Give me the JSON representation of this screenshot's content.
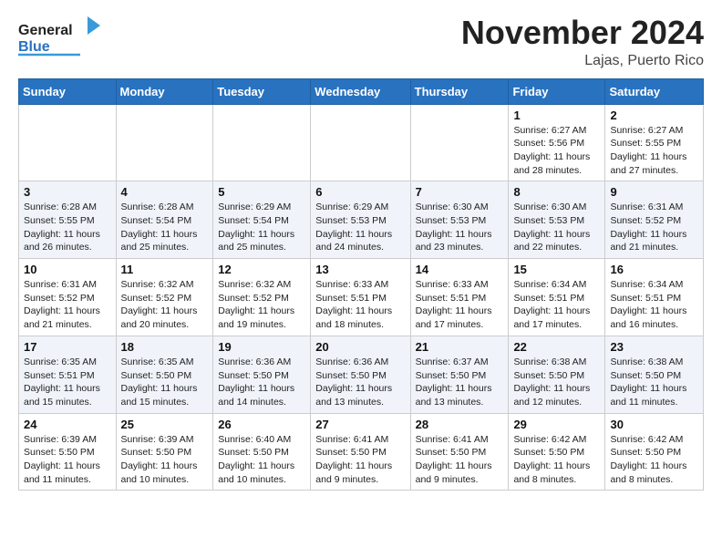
{
  "header": {
    "logo_line1": "General",
    "logo_line2": "Blue",
    "month": "November 2024",
    "location": "Lajas, Puerto Rico"
  },
  "weekdays": [
    "Sunday",
    "Monday",
    "Tuesday",
    "Wednesday",
    "Thursday",
    "Friday",
    "Saturday"
  ],
  "weeks": [
    [
      {
        "day": "",
        "info": ""
      },
      {
        "day": "",
        "info": ""
      },
      {
        "day": "",
        "info": ""
      },
      {
        "day": "",
        "info": ""
      },
      {
        "day": "",
        "info": ""
      },
      {
        "day": "1",
        "info": "Sunrise: 6:27 AM\nSunset: 5:56 PM\nDaylight: 11 hours\nand 28 minutes."
      },
      {
        "day": "2",
        "info": "Sunrise: 6:27 AM\nSunset: 5:55 PM\nDaylight: 11 hours\nand 27 minutes."
      }
    ],
    [
      {
        "day": "3",
        "info": "Sunrise: 6:28 AM\nSunset: 5:55 PM\nDaylight: 11 hours\nand 26 minutes."
      },
      {
        "day": "4",
        "info": "Sunrise: 6:28 AM\nSunset: 5:54 PM\nDaylight: 11 hours\nand 25 minutes."
      },
      {
        "day": "5",
        "info": "Sunrise: 6:29 AM\nSunset: 5:54 PM\nDaylight: 11 hours\nand 25 minutes."
      },
      {
        "day": "6",
        "info": "Sunrise: 6:29 AM\nSunset: 5:53 PM\nDaylight: 11 hours\nand 24 minutes."
      },
      {
        "day": "7",
        "info": "Sunrise: 6:30 AM\nSunset: 5:53 PM\nDaylight: 11 hours\nand 23 minutes."
      },
      {
        "day": "8",
        "info": "Sunrise: 6:30 AM\nSunset: 5:53 PM\nDaylight: 11 hours\nand 22 minutes."
      },
      {
        "day": "9",
        "info": "Sunrise: 6:31 AM\nSunset: 5:52 PM\nDaylight: 11 hours\nand 21 minutes."
      }
    ],
    [
      {
        "day": "10",
        "info": "Sunrise: 6:31 AM\nSunset: 5:52 PM\nDaylight: 11 hours\nand 21 minutes."
      },
      {
        "day": "11",
        "info": "Sunrise: 6:32 AM\nSunset: 5:52 PM\nDaylight: 11 hours\nand 20 minutes."
      },
      {
        "day": "12",
        "info": "Sunrise: 6:32 AM\nSunset: 5:52 PM\nDaylight: 11 hours\nand 19 minutes."
      },
      {
        "day": "13",
        "info": "Sunrise: 6:33 AM\nSunset: 5:51 PM\nDaylight: 11 hours\nand 18 minutes."
      },
      {
        "day": "14",
        "info": "Sunrise: 6:33 AM\nSunset: 5:51 PM\nDaylight: 11 hours\nand 17 minutes."
      },
      {
        "day": "15",
        "info": "Sunrise: 6:34 AM\nSunset: 5:51 PM\nDaylight: 11 hours\nand 17 minutes."
      },
      {
        "day": "16",
        "info": "Sunrise: 6:34 AM\nSunset: 5:51 PM\nDaylight: 11 hours\nand 16 minutes."
      }
    ],
    [
      {
        "day": "17",
        "info": "Sunrise: 6:35 AM\nSunset: 5:51 PM\nDaylight: 11 hours\nand 15 minutes."
      },
      {
        "day": "18",
        "info": "Sunrise: 6:35 AM\nSunset: 5:50 PM\nDaylight: 11 hours\nand 15 minutes."
      },
      {
        "day": "19",
        "info": "Sunrise: 6:36 AM\nSunset: 5:50 PM\nDaylight: 11 hours\nand 14 minutes."
      },
      {
        "day": "20",
        "info": "Sunrise: 6:36 AM\nSunset: 5:50 PM\nDaylight: 11 hours\nand 13 minutes."
      },
      {
        "day": "21",
        "info": "Sunrise: 6:37 AM\nSunset: 5:50 PM\nDaylight: 11 hours\nand 13 minutes."
      },
      {
        "day": "22",
        "info": "Sunrise: 6:38 AM\nSunset: 5:50 PM\nDaylight: 11 hours\nand 12 minutes."
      },
      {
        "day": "23",
        "info": "Sunrise: 6:38 AM\nSunset: 5:50 PM\nDaylight: 11 hours\nand 11 minutes."
      }
    ],
    [
      {
        "day": "24",
        "info": "Sunrise: 6:39 AM\nSunset: 5:50 PM\nDaylight: 11 hours\nand 11 minutes."
      },
      {
        "day": "25",
        "info": "Sunrise: 6:39 AM\nSunset: 5:50 PM\nDaylight: 11 hours\nand 10 minutes."
      },
      {
        "day": "26",
        "info": "Sunrise: 6:40 AM\nSunset: 5:50 PM\nDaylight: 11 hours\nand 10 minutes."
      },
      {
        "day": "27",
        "info": "Sunrise: 6:41 AM\nSunset: 5:50 PM\nDaylight: 11 hours\nand 9 minutes."
      },
      {
        "day": "28",
        "info": "Sunrise: 6:41 AM\nSunset: 5:50 PM\nDaylight: 11 hours\nand 9 minutes."
      },
      {
        "day": "29",
        "info": "Sunrise: 6:42 AM\nSunset: 5:50 PM\nDaylight: 11 hours\nand 8 minutes."
      },
      {
        "day": "30",
        "info": "Sunrise: 6:42 AM\nSunset: 5:50 PM\nDaylight: 11 hours\nand 8 minutes."
      }
    ]
  ]
}
